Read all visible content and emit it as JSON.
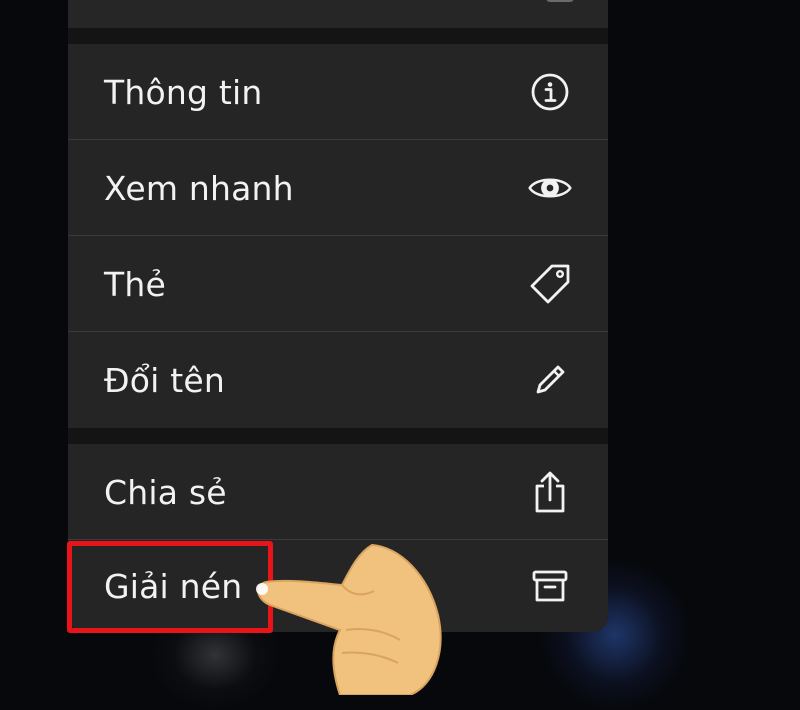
{
  "context_menu": {
    "items": [
      {
        "label": "Thông tin",
        "icon": "info-icon"
      },
      {
        "label": "Xem nhanh",
        "icon": "eye-icon"
      },
      {
        "label": "Thẻ",
        "icon": "tag-icon"
      },
      {
        "label": "Đổi tên",
        "icon": "pencil-icon"
      },
      {
        "label": "Chia sẻ",
        "icon": "share-icon"
      },
      {
        "label": "Giải nén",
        "icon": "archive-box-icon"
      }
    ]
  },
  "annotation": {
    "highlight_color": "#e8141a",
    "pointer": "pointing-hand-icon"
  },
  "colors": {
    "menu_background": "#252525",
    "text": "#f2f2f2",
    "separator": "#3a3a3c"
  }
}
